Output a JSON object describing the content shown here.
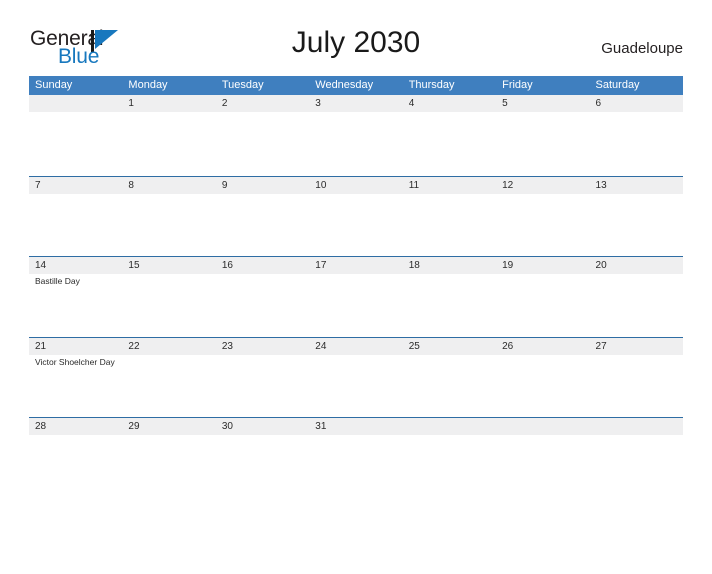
{
  "brand": {
    "name_part1": "General",
    "name_part2": "Blue",
    "flag_icon": "brand-flag-icon",
    "colors": {
      "text": "#231f20",
      "accent": "#1878be"
    }
  },
  "header": {
    "title": "July 2030",
    "region": "Guadeloupe"
  },
  "theme": {
    "header_blue": "#3f7fbf",
    "row_line_blue": "#2e6da4",
    "band_gray": "#efeff0",
    "page_background": "#ffffff",
    "text": "#2b2b2b"
  },
  "calendar": {
    "month": "July",
    "year": "2030",
    "weekday_headers": [
      "Sunday",
      "Monday",
      "Tuesday",
      "Wednesday",
      "Thursday",
      "Friday",
      "Saturday"
    ],
    "weeks": [
      [
        {
          "day": "",
          "events": []
        },
        {
          "day": "1",
          "events": []
        },
        {
          "day": "2",
          "events": []
        },
        {
          "day": "3",
          "events": []
        },
        {
          "day": "4",
          "events": []
        },
        {
          "day": "5",
          "events": []
        },
        {
          "day": "6",
          "events": []
        }
      ],
      [
        {
          "day": "7",
          "events": []
        },
        {
          "day": "8",
          "events": []
        },
        {
          "day": "9",
          "events": []
        },
        {
          "day": "10",
          "events": []
        },
        {
          "day": "11",
          "events": []
        },
        {
          "day": "12",
          "events": []
        },
        {
          "day": "13",
          "events": []
        }
      ],
      [
        {
          "day": "14",
          "events": [
            "Bastille Day"
          ]
        },
        {
          "day": "15",
          "events": []
        },
        {
          "day": "16",
          "events": []
        },
        {
          "day": "17",
          "events": []
        },
        {
          "day": "18",
          "events": []
        },
        {
          "day": "19",
          "events": []
        },
        {
          "day": "20",
          "events": []
        }
      ],
      [
        {
          "day": "21",
          "events": [
            "Victor Shoelcher Day"
          ]
        },
        {
          "day": "22",
          "events": []
        },
        {
          "day": "23",
          "events": []
        },
        {
          "day": "24",
          "events": []
        },
        {
          "day": "25",
          "events": []
        },
        {
          "day": "26",
          "events": []
        },
        {
          "day": "27",
          "events": []
        }
      ],
      [
        {
          "day": "28",
          "events": []
        },
        {
          "day": "29",
          "events": []
        },
        {
          "day": "30",
          "events": []
        },
        {
          "day": "31",
          "events": []
        },
        {
          "day": "",
          "events": []
        },
        {
          "day": "",
          "events": []
        },
        {
          "day": "",
          "events": []
        }
      ]
    ]
  }
}
